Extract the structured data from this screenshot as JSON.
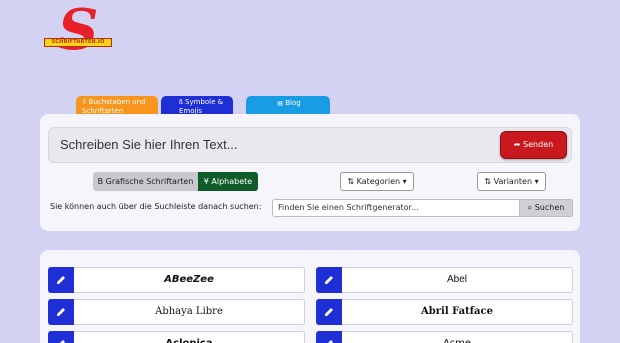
{
  "logo": {
    "letter": "S",
    "band_text": "SCHRIFTARTEN.IO"
  },
  "tabs": [
    {
      "icon": "text-icon",
      "label": "Buchstaben und Schriftarten",
      "color": "#f7951d"
    },
    {
      "icon": "symbol-icon",
      "label": "Symbole & Emojis",
      "color": "#1f2fd6"
    },
    {
      "icon": "blog-icon",
      "label": "Blog",
      "color": "#189ce4"
    }
  ],
  "editor": {
    "placeholder": "Schreiben Sie hier Ihren Text...",
    "send_label": "Senden"
  },
  "filters": {
    "grafische_label": "Grafische Schriftarten",
    "alphabete_label": "Alphabete",
    "kategorien_label": "Kategorien",
    "varianten_label": "Varianten"
  },
  "search": {
    "label": "Sie können auch über die Suchleiste danach suchen:",
    "placeholder": "Finden Sie einen Schriftgenerator...",
    "button_label": "Suchen"
  },
  "fonts": [
    {
      "name": "ABeeZee"
    },
    {
      "name": "Abel"
    },
    {
      "name": "Abhaya Libre"
    },
    {
      "name": "Abril Fatface"
    },
    {
      "name": "Aclonica"
    },
    {
      "name": "Acme"
    }
  ],
  "colors": {
    "page_bg": "#d4d2f2",
    "send": "#c9181e",
    "alphabete": "#0f5c2a",
    "edit": "#1f2fd6"
  }
}
